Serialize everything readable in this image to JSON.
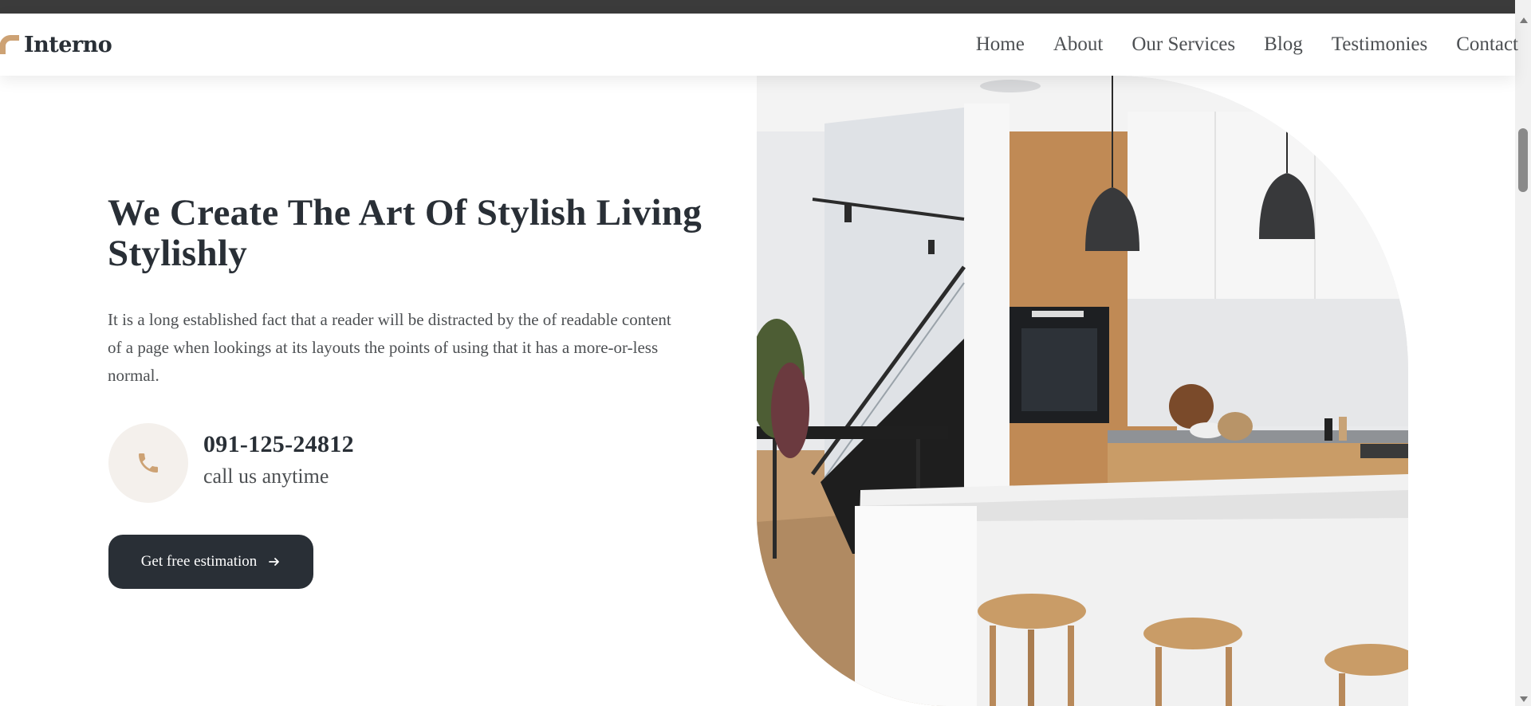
{
  "brand": {
    "name": "Interno"
  },
  "nav": {
    "items": [
      {
        "label": "Home"
      },
      {
        "label": "About"
      },
      {
        "label": "Our Services"
      },
      {
        "label": "Blog"
      },
      {
        "label": "Testimonies"
      },
      {
        "label": "Contact"
      }
    ]
  },
  "hero": {
    "title": "We Create The Art Of Stylish Living Stylishly",
    "description": "It is a long established fact that a reader will be distracted by the of readable content of a page when lookings at its layouts the points of using that it has a more-or-less normal.",
    "phone_number": "091-125-24812",
    "phone_caption": "call us anytime",
    "cta_label": "Get free estimation"
  },
  "icons": {
    "logo": "arch-logo-icon",
    "phone": "phone-icon",
    "cta_arrow": "arrow-right-icon"
  },
  "colors": {
    "accent": "#cda274",
    "dark": "#292f36",
    "text": "#4d5053",
    "icon_bg": "#f4f0ec"
  }
}
